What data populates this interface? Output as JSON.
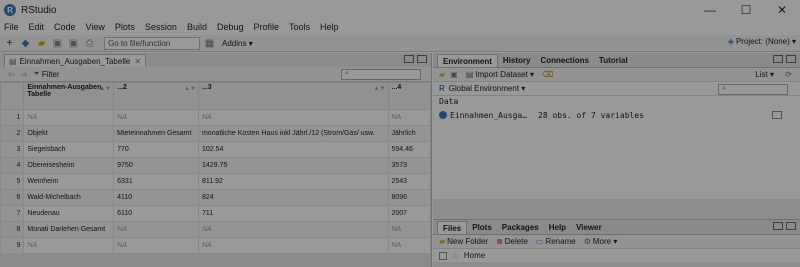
{
  "app": {
    "title": "RStudio",
    "icon_letter": "R"
  },
  "window_controls": {
    "minimize": "—",
    "maximize": "☐",
    "close": "✕"
  },
  "menu": [
    "File",
    "Edit",
    "Code",
    "View",
    "Plots",
    "Session",
    "Build",
    "Debug",
    "Profile",
    "Tools",
    "Help"
  ],
  "toolbar": {
    "goto_placeholder": "Go to file/function",
    "addins": "Addins",
    "project": "Project: (None)"
  },
  "source": {
    "tab_label": "Einnahmen_Ausgaben_Tabelle",
    "filter_label": "Filter",
    "columns": [
      "Einnahmen-Ausgaben Tabelle",
      "...2",
      "...3",
      "...4"
    ],
    "rows": [
      [
        "1",
        "NA",
        "NA",
        "NA",
        "NA"
      ],
      [
        "2",
        "Objekt",
        "Mieteinnahmen Gesamt",
        "monatliche Kosten Haus inkl Jährl./12  (Strom/Gas/ usw.",
        "Jährlich"
      ],
      [
        "3",
        "Siegelsbach",
        "770",
        "102.54",
        "594.46"
      ],
      [
        "4",
        "Obereisesheim",
        "9750",
        "1429.75",
        "3573"
      ],
      [
        "5",
        "Weinheim",
        "6331",
        "811.92",
        "2543"
      ],
      [
        "6",
        "Wald-Michelbach",
        "4110",
        "824",
        "8096"
      ],
      [
        "7",
        "Neudenau",
        "6110",
        "711",
        "2007"
      ],
      [
        "8",
        "Monati Darlehen Gesamt",
        "NA",
        "NA",
        "NA"
      ],
      [
        "9",
        "NA",
        "NA",
        "NA",
        "NA"
      ]
    ]
  },
  "environment": {
    "tabs": [
      "Environment",
      "History",
      "Connections",
      "Tutorial"
    ],
    "import_label": "Import Dataset",
    "list_label": "List",
    "scope": "Global Environment",
    "section": "Data",
    "object_name": "Einnahmen_Ausga…",
    "object_desc": "28 obs. of 7 variables"
  },
  "files": {
    "tabs": [
      "Files",
      "Plots",
      "Packages",
      "Help",
      "Viewer"
    ],
    "actions": [
      "New Folder",
      "Delete",
      "Rename",
      "More"
    ],
    "home": "Home"
  }
}
